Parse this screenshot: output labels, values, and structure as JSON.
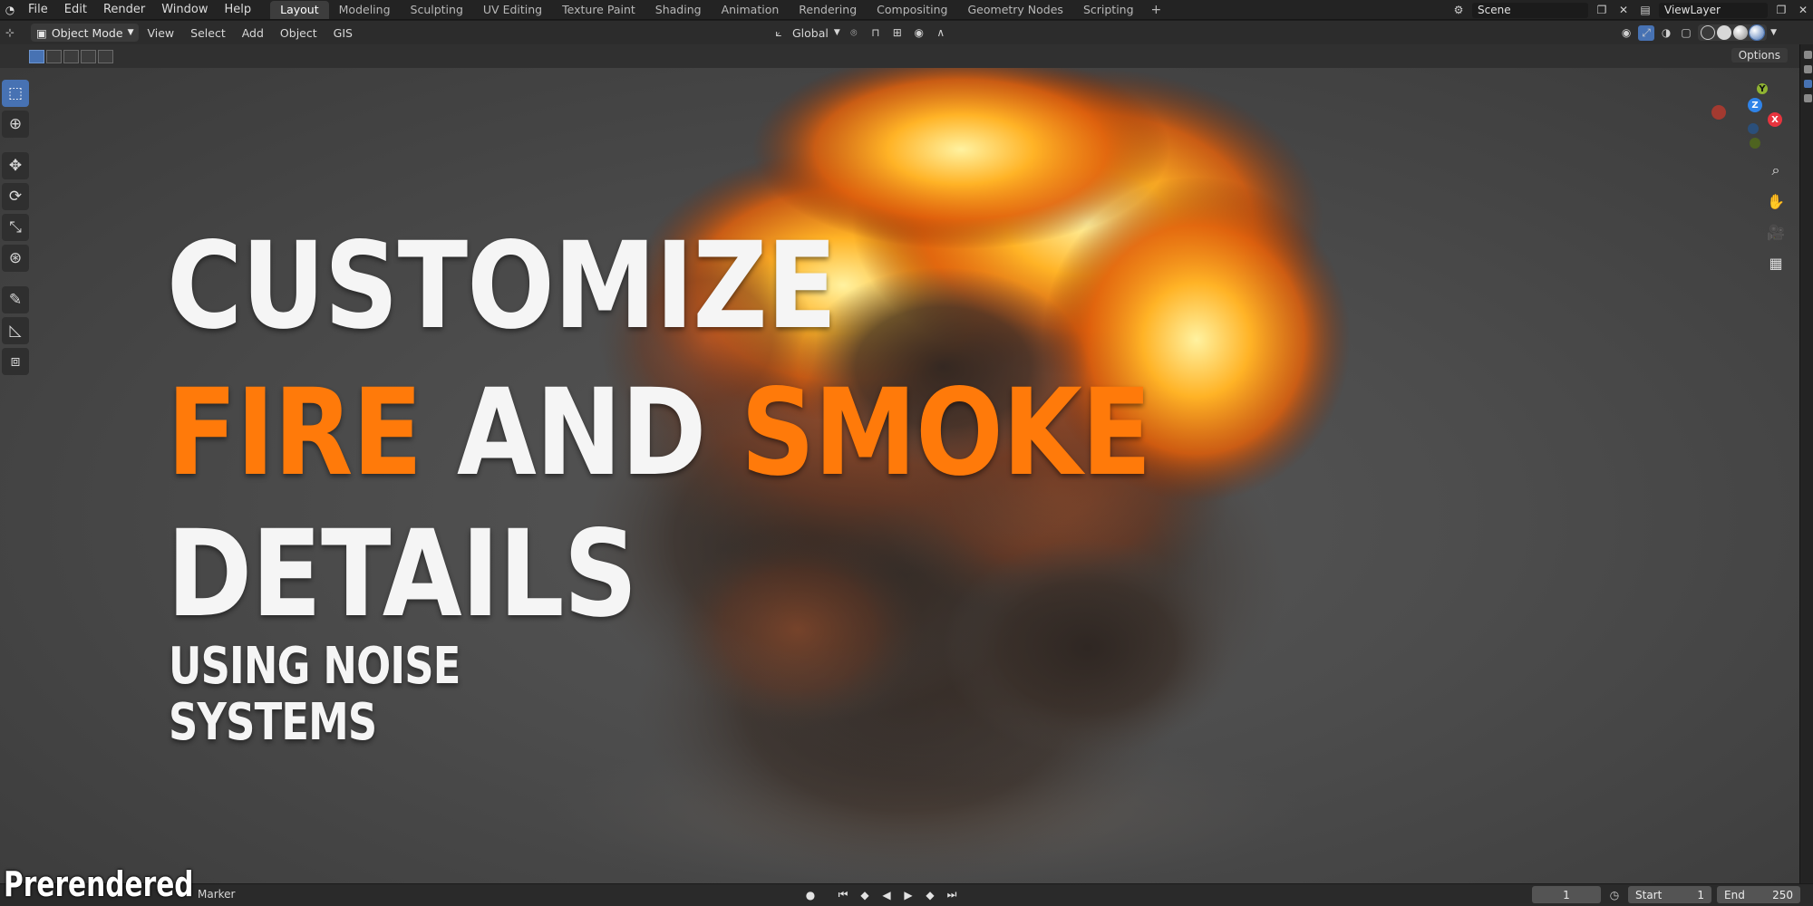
{
  "menu": {
    "items": [
      "File",
      "Edit",
      "Render",
      "Window",
      "Help"
    ]
  },
  "workspaces": {
    "tabs": [
      "Layout",
      "Modeling",
      "Sculpting",
      "UV Editing",
      "Texture Paint",
      "Shading",
      "Animation",
      "Rendering",
      "Compositing",
      "Geometry Nodes",
      "Scripting"
    ],
    "active": "Layout",
    "add_symbol": "+"
  },
  "scene": {
    "name": "Scene",
    "view_layer": "ViewLayer"
  },
  "header": {
    "mode": "Object Mode",
    "menus": [
      "View",
      "Select",
      "Add",
      "Object",
      "GIS"
    ],
    "transform_orientation": "Global"
  },
  "tool_settings": {
    "options_label": "Options"
  },
  "overlay_text": {
    "line1": "CUSTOMIZE",
    "line2_a": "FIRE",
    "line2_b": "AND",
    "line2_c": "SMOKE",
    "line3": "DETAILS",
    "sub1": "USING NOISE",
    "sub2": "SYSTEMS",
    "badge": "Prerendered"
  },
  "gizmo": {
    "x": "X",
    "y": "Y",
    "z": "Z"
  },
  "timeline": {
    "marker_label": "Marker",
    "current_frame": "1",
    "start_label": "Start",
    "start_value": "1",
    "end_label": "End",
    "end_value": "250"
  },
  "colors": {
    "accent": "#4772b3",
    "title_orange": "#ff7a0a"
  }
}
